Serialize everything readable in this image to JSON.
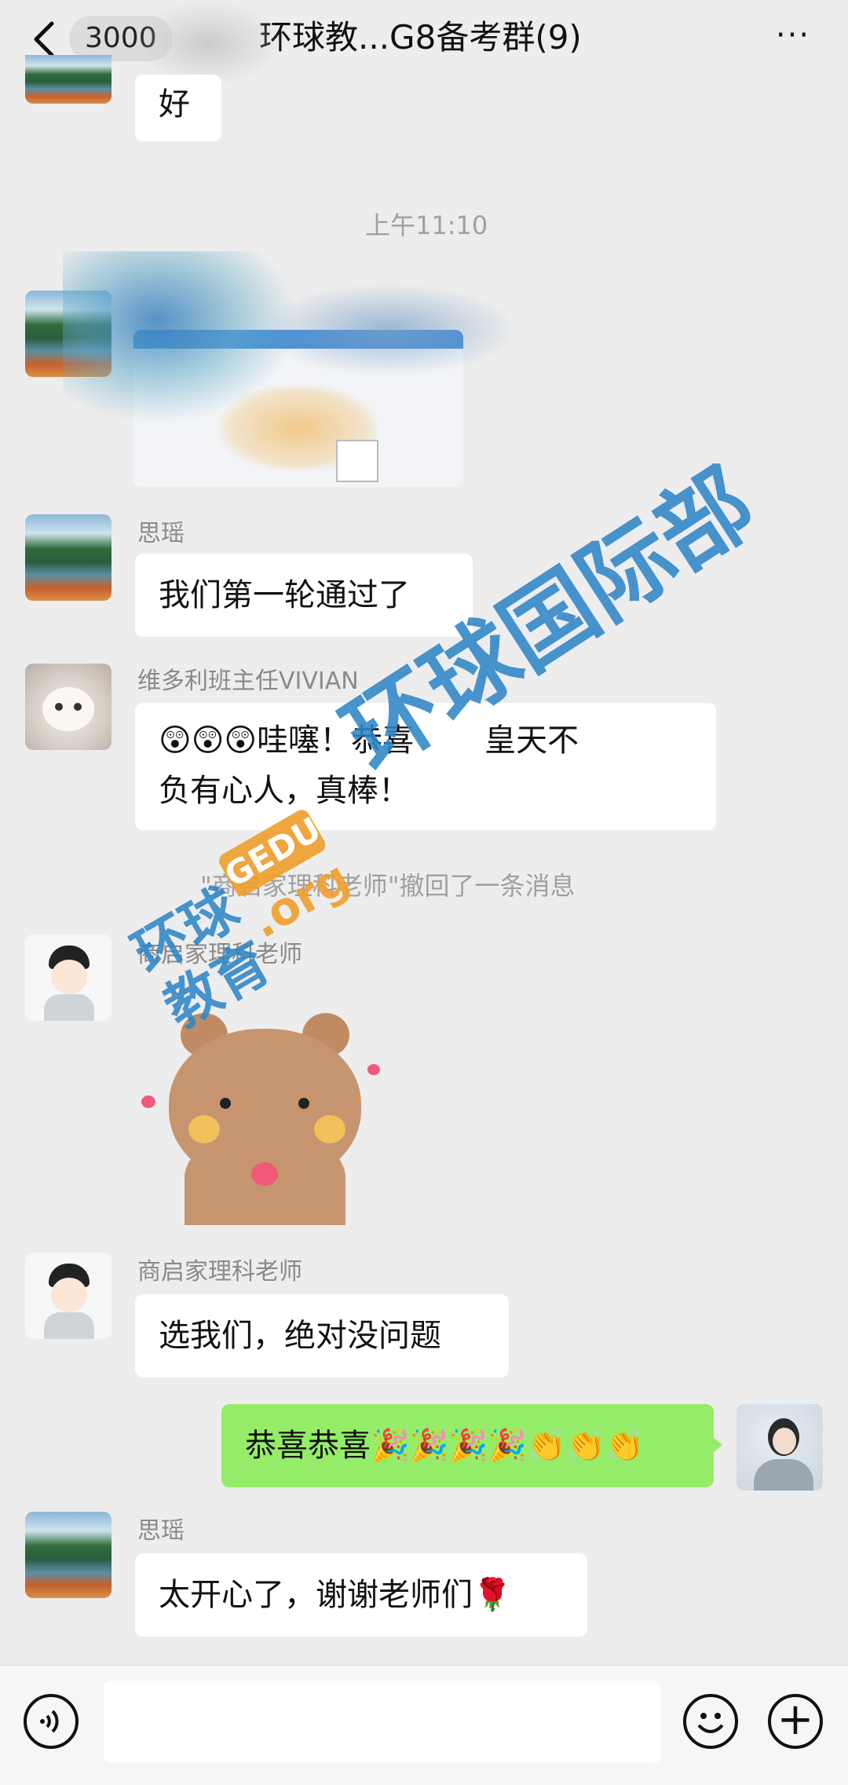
{
  "header": {
    "back_icon": "chevron-left-icon",
    "unread_count": "3000",
    "title": "环球教...G8备考群(9)",
    "more_icon": "more-dots-icon",
    "more_label": "···"
  },
  "messages": {
    "top_partial_text": "好",
    "timestamp": "上午11:10",
    "m1": {
      "sender": "思瑶",
      "text": "我们第一轮通过了"
    },
    "m2": {
      "sender": "维多利班主任VIVIAN",
      "line1": "😲😲😲哇噻！恭喜",
      "line1_end": "皇天不",
      "line2": "负有心人，真棒！"
    },
    "recall": "\"商启家理科老师\"撤回了一条消息",
    "m3": {
      "sender": "商启家理科老师"
    },
    "m4": {
      "sender": "商启家理科老师",
      "text": "选我们，绝对没问题"
    },
    "m5": {
      "text": "恭喜恭喜🎉🎉🎉🎉👏👏👏"
    },
    "m6": {
      "sender": "思瑶",
      "text": "太开心了，谢谢老师们🌹"
    }
  },
  "watermark": {
    "main": "环球国际部",
    "badge_line1": "环球",
    "badge_line2": "教育",
    "badge_tag": "GEDU",
    "badge_domain": ".org"
  },
  "input_bar": {
    "voice_icon": "voice-icon",
    "emoji_icon": "emoji-icon",
    "plus_icon": "plus-icon",
    "plus_label": "+"
  },
  "colors": {
    "background": "#ededed",
    "my_bubble": "#95ec69",
    "other_bubble": "#ffffff",
    "watermark": "#2f86c7",
    "badge": "#f0a030"
  }
}
